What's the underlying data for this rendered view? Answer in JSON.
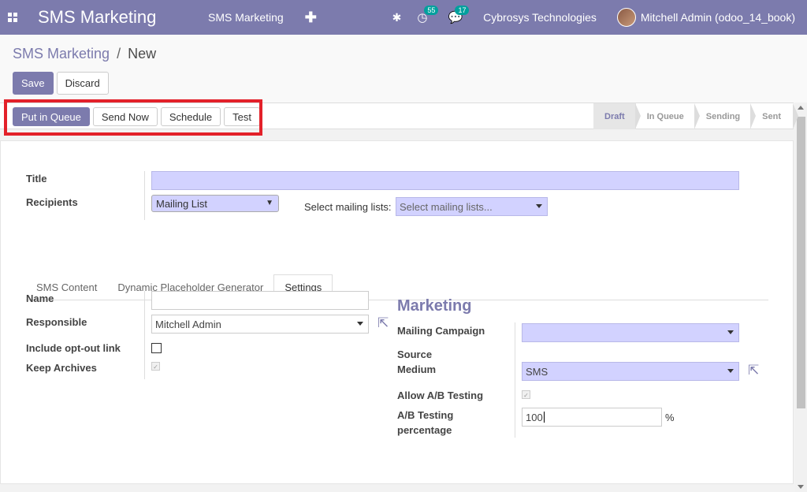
{
  "navbar": {
    "brand": "SMS Marketing",
    "menu_item": "SMS Marketing",
    "activity_count": "55",
    "message_count": "17",
    "company": "Cybrosys Technologies",
    "user": "Mitchell Admin (odoo_14_book)",
    "color": "#7c7bad"
  },
  "breadcrumb": {
    "parent": "SMS Marketing",
    "separator": "/",
    "current": "New"
  },
  "control": {
    "save": "Save",
    "discard": "Discard"
  },
  "statusbar": {
    "actions": [
      "Put in Queue",
      "Send Now",
      "Schedule",
      "Test"
    ],
    "stages": [
      "Draft",
      "In Queue",
      "Sending",
      "Sent"
    ],
    "active_stage": "Draft"
  },
  "form": {
    "title_label": "Title",
    "title_value": "",
    "recipients_label": "Recipients",
    "recipients_value": "Mailing List",
    "mailing_lists_label": "Select mailing lists:",
    "mailing_lists_placeholder": "Select mailing lists...",
    "tabs": [
      "SMS Content",
      "Dynamic Placeholder Generator",
      "Settings"
    ],
    "active_tab": "Settings"
  },
  "settings": {
    "name_label": "Name",
    "name_value": "",
    "responsible_label": "Responsible",
    "responsible_value": "Mitchell Admin",
    "optout_label": "Include opt-out link",
    "archives_label": "Keep Archives",
    "marketing_title": "Marketing",
    "campaign_label": "Mailing Campaign",
    "source_label": "Source",
    "medium_label": "Medium",
    "medium_value": "SMS",
    "ab_label": "Allow A/B Testing",
    "ab_pct_label_1": "A/B Testing",
    "ab_pct_label_2": "percentage",
    "ab_pct_value": "100",
    "ab_pct_unit": "%"
  }
}
